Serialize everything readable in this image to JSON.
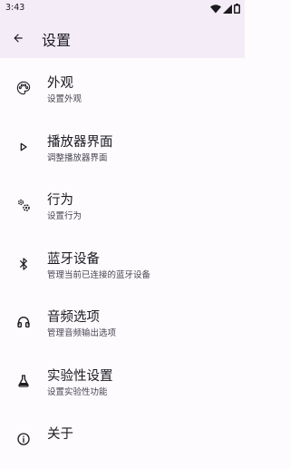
{
  "status_bar": {
    "time": "3:43",
    "icons": [
      "wifi-icon",
      "signal-icon",
      "battery-icon"
    ]
  },
  "app_bar": {
    "back_icon": "arrow-back-icon",
    "title": "设置"
  },
  "colors": {
    "app_bar_bg": "#f4ecf7",
    "page_bg": "#fefbff",
    "text_primary": "#1b1b1f",
    "text_secondary": "#46464f"
  },
  "settings": {
    "items": [
      {
        "icon": "palette-icon",
        "title": "外观",
        "subtitle": "设置外观"
      },
      {
        "icon": "play-icon",
        "title": "播放器界面",
        "subtitle": "调整播放器界面"
      },
      {
        "icon": "settings-gears-icon",
        "title": "行为",
        "subtitle": "设置行为"
      },
      {
        "icon": "bluetooth-icon",
        "title": "蓝牙设备",
        "subtitle": "管理当前已连接的蓝牙设备"
      },
      {
        "icon": "headphones-icon",
        "title": "音频选项",
        "subtitle": "管理音频输出选项"
      },
      {
        "icon": "flask-icon",
        "title": "实验性设置",
        "subtitle": "设置实验性功能"
      },
      {
        "icon": "info-icon",
        "title": "关于",
        "subtitle": ""
      }
    ]
  }
}
